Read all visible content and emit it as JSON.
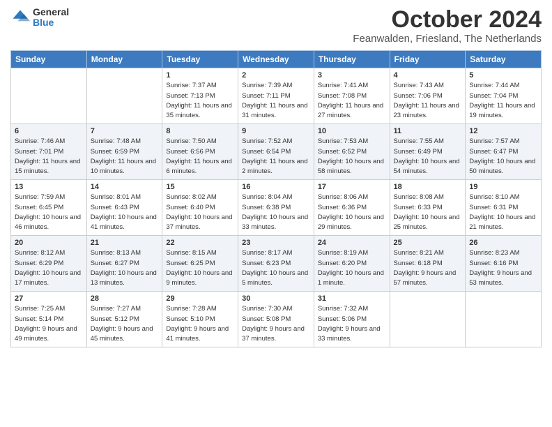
{
  "logo": {
    "line1": "General",
    "line2": "Blue"
  },
  "title": "October 2024",
  "location": "Feanwalden, Friesland, The Netherlands",
  "headers": [
    "Sunday",
    "Monday",
    "Tuesday",
    "Wednesday",
    "Thursday",
    "Friday",
    "Saturday"
  ],
  "weeks": [
    [
      {
        "day": "",
        "sunrise": "",
        "sunset": "",
        "daylight": ""
      },
      {
        "day": "",
        "sunrise": "",
        "sunset": "",
        "daylight": ""
      },
      {
        "day": "1",
        "sunrise": "Sunrise: 7:37 AM",
        "sunset": "Sunset: 7:13 PM",
        "daylight": "Daylight: 11 hours and 35 minutes."
      },
      {
        "day": "2",
        "sunrise": "Sunrise: 7:39 AM",
        "sunset": "Sunset: 7:11 PM",
        "daylight": "Daylight: 11 hours and 31 minutes."
      },
      {
        "day": "3",
        "sunrise": "Sunrise: 7:41 AM",
        "sunset": "Sunset: 7:08 PM",
        "daylight": "Daylight: 11 hours and 27 minutes."
      },
      {
        "day": "4",
        "sunrise": "Sunrise: 7:43 AM",
        "sunset": "Sunset: 7:06 PM",
        "daylight": "Daylight: 11 hours and 23 minutes."
      },
      {
        "day": "5",
        "sunrise": "Sunrise: 7:44 AM",
        "sunset": "Sunset: 7:04 PM",
        "daylight": "Daylight: 11 hours and 19 minutes."
      }
    ],
    [
      {
        "day": "6",
        "sunrise": "Sunrise: 7:46 AM",
        "sunset": "Sunset: 7:01 PM",
        "daylight": "Daylight: 11 hours and 15 minutes."
      },
      {
        "day": "7",
        "sunrise": "Sunrise: 7:48 AM",
        "sunset": "Sunset: 6:59 PM",
        "daylight": "Daylight: 11 hours and 10 minutes."
      },
      {
        "day": "8",
        "sunrise": "Sunrise: 7:50 AM",
        "sunset": "Sunset: 6:56 PM",
        "daylight": "Daylight: 11 hours and 6 minutes."
      },
      {
        "day": "9",
        "sunrise": "Sunrise: 7:52 AM",
        "sunset": "Sunset: 6:54 PM",
        "daylight": "Daylight: 11 hours and 2 minutes."
      },
      {
        "day": "10",
        "sunrise": "Sunrise: 7:53 AM",
        "sunset": "Sunset: 6:52 PM",
        "daylight": "Daylight: 10 hours and 58 minutes."
      },
      {
        "day": "11",
        "sunrise": "Sunrise: 7:55 AM",
        "sunset": "Sunset: 6:49 PM",
        "daylight": "Daylight: 10 hours and 54 minutes."
      },
      {
        "day": "12",
        "sunrise": "Sunrise: 7:57 AM",
        "sunset": "Sunset: 6:47 PM",
        "daylight": "Daylight: 10 hours and 50 minutes."
      }
    ],
    [
      {
        "day": "13",
        "sunrise": "Sunrise: 7:59 AM",
        "sunset": "Sunset: 6:45 PM",
        "daylight": "Daylight: 10 hours and 46 minutes."
      },
      {
        "day": "14",
        "sunrise": "Sunrise: 8:01 AM",
        "sunset": "Sunset: 6:43 PM",
        "daylight": "Daylight: 10 hours and 41 minutes."
      },
      {
        "day": "15",
        "sunrise": "Sunrise: 8:02 AM",
        "sunset": "Sunset: 6:40 PM",
        "daylight": "Daylight: 10 hours and 37 minutes."
      },
      {
        "day": "16",
        "sunrise": "Sunrise: 8:04 AM",
        "sunset": "Sunset: 6:38 PM",
        "daylight": "Daylight: 10 hours and 33 minutes."
      },
      {
        "day": "17",
        "sunrise": "Sunrise: 8:06 AM",
        "sunset": "Sunset: 6:36 PM",
        "daylight": "Daylight: 10 hours and 29 minutes."
      },
      {
        "day": "18",
        "sunrise": "Sunrise: 8:08 AM",
        "sunset": "Sunset: 6:33 PM",
        "daylight": "Daylight: 10 hours and 25 minutes."
      },
      {
        "day": "19",
        "sunrise": "Sunrise: 8:10 AM",
        "sunset": "Sunset: 6:31 PM",
        "daylight": "Daylight: 10 hours and 21 minutes."
      }
    ],
    [
      {
        "day": "20",
        "sunrise": "Sunrise: 8:12 AM",
        "sunset": "Sunset: 6:29 PM",
        "daylight": "Daylight: 10 hours and 17 minutes."
      },
      {
        "day": "21",
        "sunrise": "Sunrise: 8:13 AM",
        "sunset": "Sunset: 6:27 PM",
        "daylight": "Daylight: 10 hours and 13 minutes."
      },
      {
        "day": "22",
        "sunrise": "Sunrise: 8:15 AM",
        "sunset": "Sunset: 6:25 PM",
        "daylight": "Daylight: 10 hours and 9 minutes."
      },
      {
        "day": "23",
        "sunrise": "Sunrise: 8:17 AM",
        "sunset": "Sunset: 6:23 PM",
        "daylight": "Daylight: 10 hours and 5 minutes."
      },
      {
        "day": "24",
        "sunrise": "Sunrise: 8:19 AM",
        "sunset": "Sunset: 6:20 PM",
        "daylight": "Daylight: 10 hours and 1 minute."
      },
      {
        "day": "25",
        "sunrise": "Sunrise: 8:21 AM",
        "sunset": "Sunset: 6:18 PM",
        "daylight": "Daylight: 9 hours and 57 minutes."
      },
      {
        "day": "26",
        "sunrise": "Sunrise: 8:23 AM",
        "sunset": "Sunset: 6:16 PM",
        "daylight": "Daylight: 9 hours and 53 minutes."
      }
    ],
    [
      {
        "day": "27",
        "sunrise": "Sunrise: 7:25 AM",
        "sunset": "Sunset: 5:14 PM",
        "daylight": "Daylight: 9 hours and 49 minutes."
      },
      {
        "day": "28",
        "sunrise": "Sunrise: 7:27 AM",
        "sunset": "Sunset: 5:12 PM",
        "daylight": "Daylight: 9 hours and 45 minutes."
      },
      {
        "day": "29",
        "sunrise": "Sunrise: 7:28 AM",
        "sunset": "Sunset: 5:10 PM",
        "daylight": "Daylight: 9 hours and 41 minutes."
      },
      {
        "day": "30",
        "sunrise": "Sunrise: 7:30 AM",
        "sunset": "Sunset: 5:08 PM",
        "daylight": "Daylight: 9 hours and 37 minutes."
      },
      {
        "day": "31",
        "sunrise": "Sunrise: 7:32 AM",
        "sunset": "Sunset: 5:06 PM",
        "daylight": "Daylight: 9 hours and 33 minutes."
      },
      {
        "day": "",
        "sunrise": "",
        "sunset": "",
        "daylight": ""
      },
      {
        "day": "",
        "sunrise": "",
        "sunset": "",
        "daylight": ""
      }
    ]
  ]
}
